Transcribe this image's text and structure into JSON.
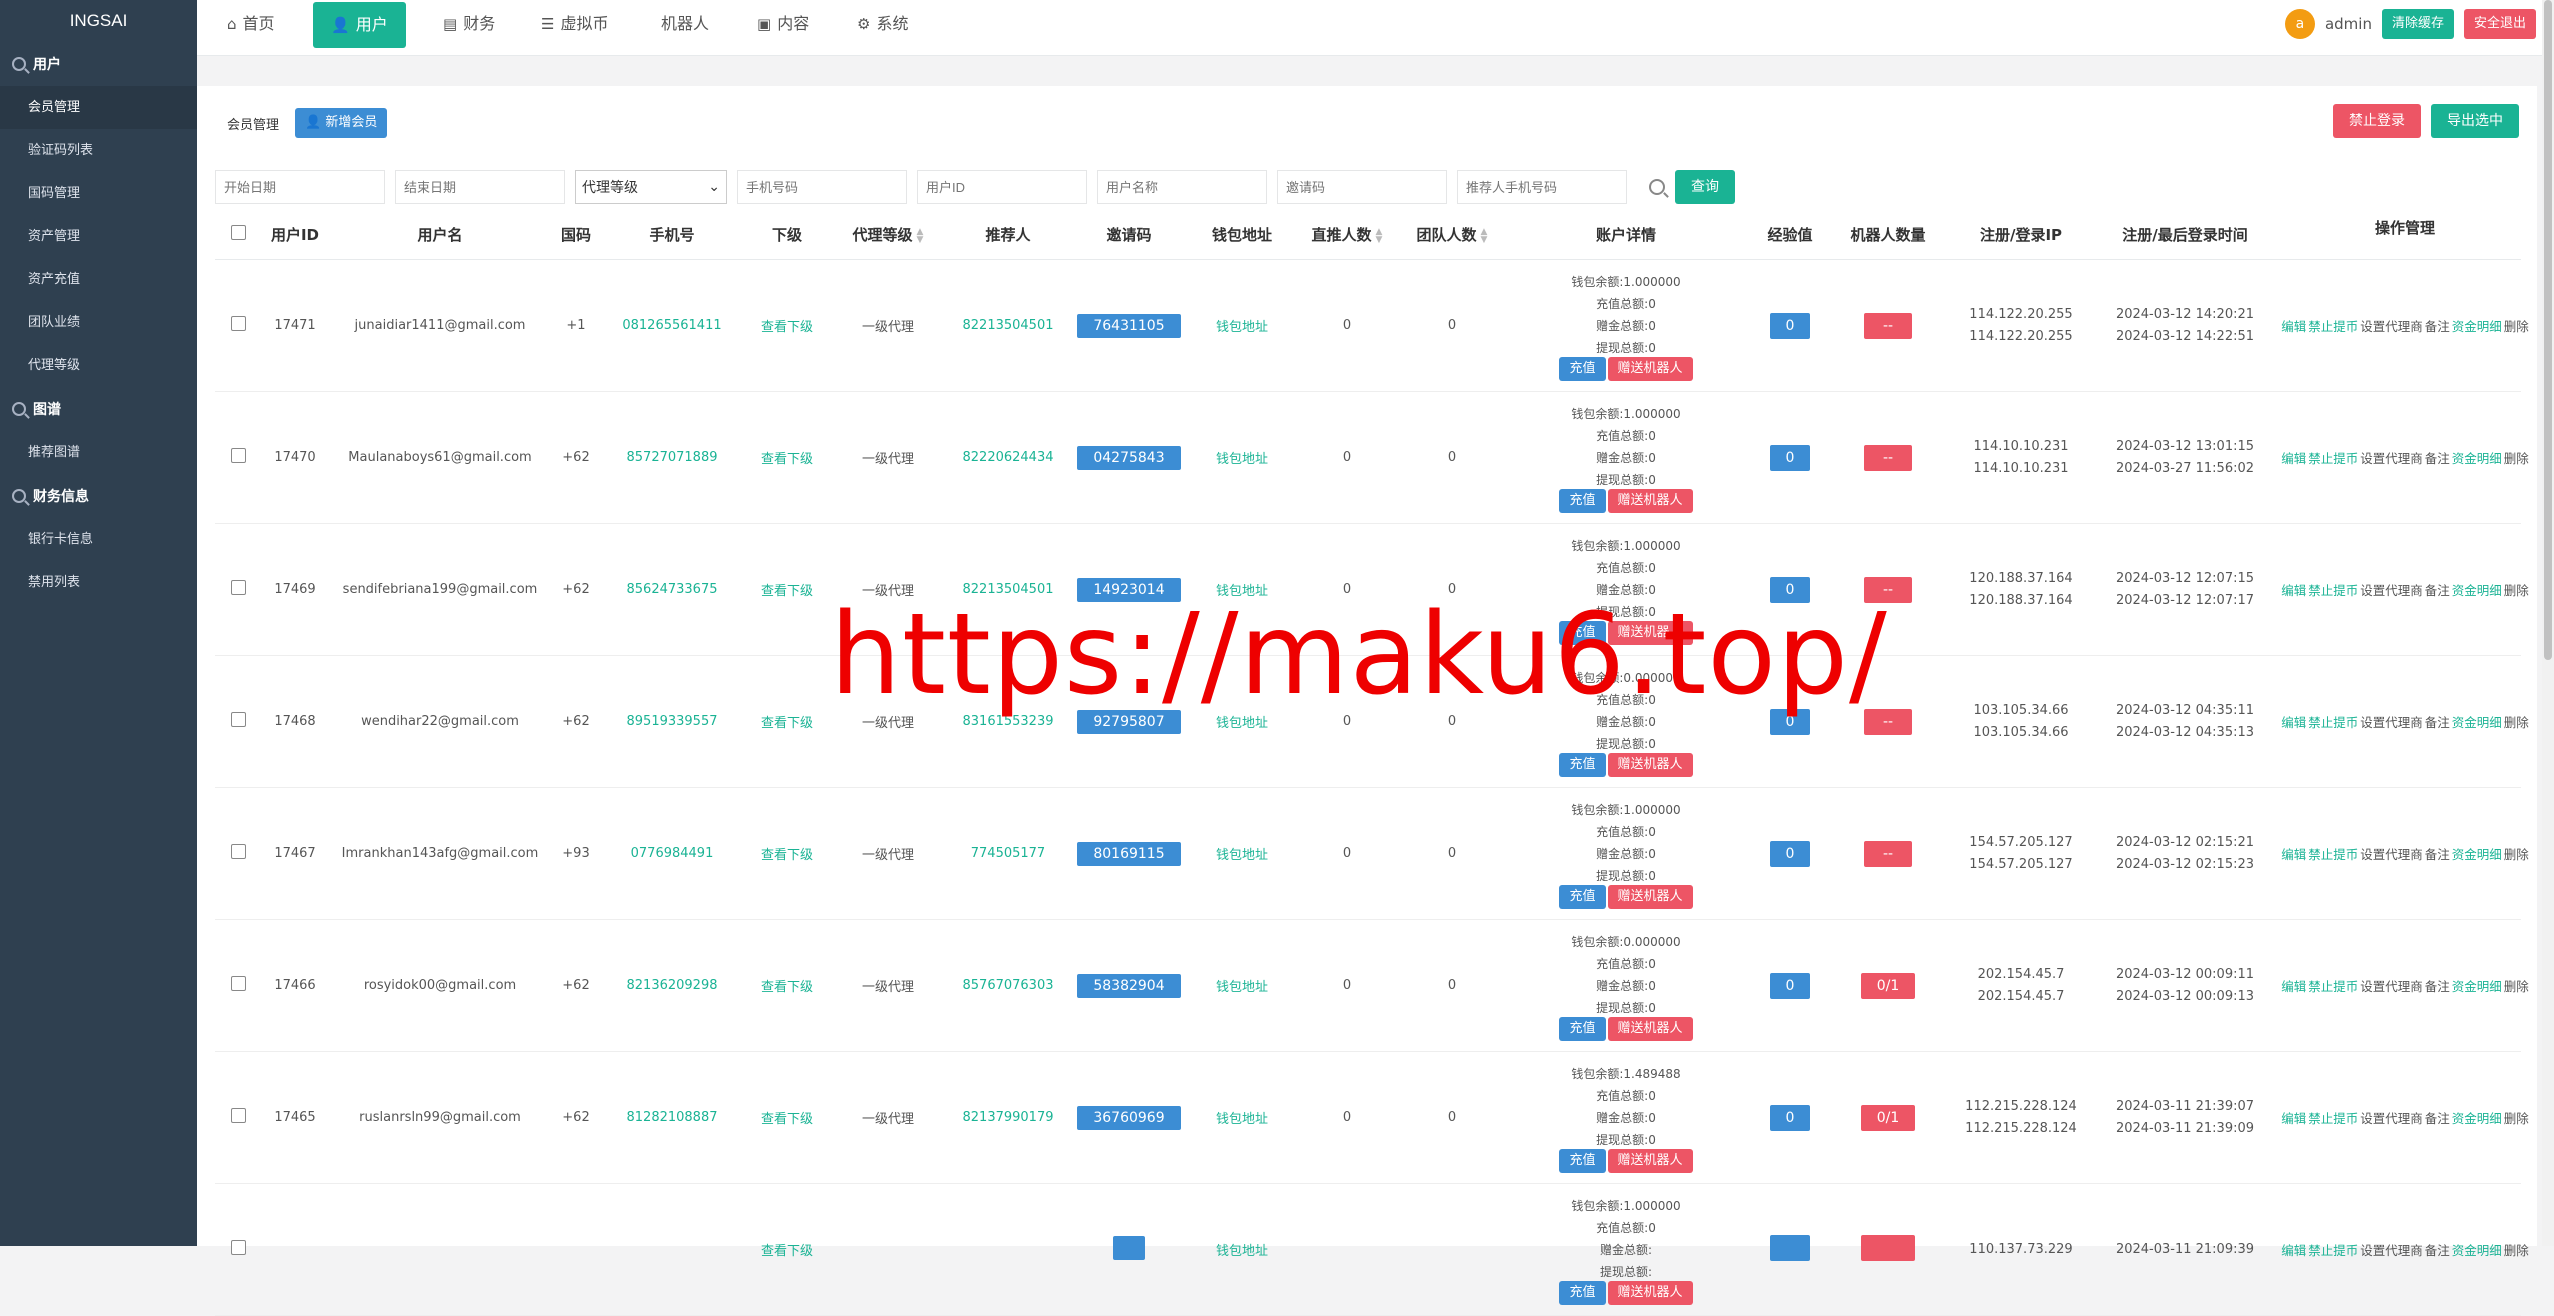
{
  "brand": "INGSAI",
  "sidebar": {
    "groups": [
      {
        "label": "用户",
        "items": [
          "会员管理",
          "验证码列表",
          "国码管理",
          "资产管理",
          "资产充值",
          "团队业绩",
          "代理等级"
        ]
      },
      {
        "label": "图谱",
        "items": [
          "推荐图谱"
        ]
      },
      {
        "label": "财务信息",
        "items": [
          "银行卡信息",
          "禁用列表"
        ]
      }
    ]
  },
  "topnav": {
    "tabs": [
      {
        "label": "首页",
        "icon": "home-icon"
      },
      {
        "label": "用户",
        "icon": "user-icon"
      },
      {
        "label": "财务",
        "icon": "wallet-icon"
      },
      {
        "label": "虚拟币",
        "icon": "database-icon"
      },
      {
        "label": "机器人",
        "icon": ""
      },
      {
        "label": "内容",
        "icon": "content-icon"
      },
      {
        "label": "系统",
        "icon": "gear-icon"
      }
    ],
    "avatar_letter": "a",
    "admin": "admin",
    "clear_cache": "清除缓存",
    "logout": "安全退出"
  },
  "page": {
    "title": "会员管理",
    "add_member": "新增会员",
    "ban_login": "禁止登录",
    "export": "导出选中"
  },
  "filters": {
    "start_date": "开始日期",
    "end_date": "结束日期",
    "agent_level": "代理等级",
    "phone": "手机号码",
    "user_id": "用户ID",
    "user_name": "用户名称",
    "invite_code": "邀请码",
    "referrer_phone": "推荐人手机号码",
    "query": "查询"
  },
  "table": {
    "headers": [
      "用户ID",
      "用户名",
      "国码",
      "手机号",
      "下级",
      "代理等级",
      "推荐人",
      "邀请码",
      "钱包地址",
      "直推人数",
      "团队人数",
      "账户详情",
      "经验值",
      "机器人数量",
      "注册/登录IP",
      "注册/最后登录时间",
      "操作管理"
    ],
    "acct_labels": {
      "balance": "钱包余额:",
      "recharge": "充值总额:",
      "gift": "赠金总额:",
      "withdraw": "提现总额:"
    },
    "btn_recharge": "充值",
    "btn_gift_robot": "赠送机器人",
    "view_sub": "查看下级",
    "wallet_link": "钱包地址",
    "ops": {
      "edit": "编辑",
      "ban_withdraw": "禁止提币",
      "set_agent": "设置代理商",
      "note": "备注",
      "funds": "资金明细",
      "delete": "删除"
    },
    "rows": [
      {
        "id": "17471",
        "name": "junaidiar1411@gmail.com",
        "cc": "+1",
        "phone": "081265561411",
        "level": "一级代理",
        "ref": "82213504501",
        "invite": "76431105",
        "direct": "0",
        "team": "0",
        "balance": "1.000000",
        "recharge": "0",
        "gift": "0",
        "withdraw": "0",
        "exp": "0",
        "robots": "--",
        "ip1": "114.122.20.255",
        "ip2": "114.122.20.255",
        "t1": "2024-03-12 14:20:21",
        "t2": "2024-03-12 14:22:51"
      },
      {
        "id": "17470",
        "name": "Maulanaboys61@gmail.com",
        "cc": "+62",
        "phone": "85727071889",
        "level": "一级代理",
        "ref": "82220624434",
        "invite": "04275843",
        "direct": "0",
        "team": "0",
        "balance": "1.000000",
        "recharge": "0",
        "gift": "0",
        "withdraw": "0",
        "exp": "0",
        "robots": "--",
        "ip1": "114.10.10.231",
        "ip2": "114.10.10.231",
        "t1": "2024-03-12 13:01:15",
        "t2": "2024-03-27 11:56:02"
      },
      {
        "id": "17469",
        "name": "sendifebriana199@gmail.com",
        "cc": "+62",
        "phone": "85624733675",
        "level": "一级代理",
        "ref": "82213504501",
        "invite": "14923014",
        "direct": "0",
        "team": "0",
        "balance": "1.000000",
        "recharge": "0",
        "gift": "0",
        "withdraw": "0",
        "exp": "0",
        "robots": "--",
        "ip1": "120.188.37.164",
        "ip2": "120.188.37.164",
        "t1": "2024-03-12 12:07:15",
        "t2": "2024-03-12 12:07:17"
      },
      {
        "id": "17468",
        "name": "wendihar22@gmail.com",
        "cc": "+62",
        "phone": "89519339557",
        "level": "一级代理",
        "ref": "83161553239",
        "invite": "92795807",
        "direct": "0",
        "team": "0",
        "balance": "0.000000",
        "recharge": "0",
        "gift": "0",
        "withdraw": "0",
        "exp": "0",
        "robots": "--",
        "ip1": "103.105.34.66",
        "ip2": "103.105.34.66",
        "t1": "2024-03-12 04:35:11",
        "t2": "2024-03-12 04:35:13"
      },
      {
        "id": "17467",
        "name": "Imrankhan143afg@gmail.com",
        "cc": "+93",
        "phone": "0776984491",
        "level": "一级代理",
        "ref": "774505177",
        "invite": "80169115",
        "direct": "0",
        "team": "0",
        "balance": "1.000000",
        "recharge": "0",
        "gift": "0",
        "withdraw": "0",
        "exp": "0",
        "robots": "--",
        "ip1": "154.57.205.127",
        "ip2": "154.57.205.127",
        "t1": "2024-03-12 02:15:21",
        "t2": "2024-03-12 02:15:23"
      },
      {
        "id": "17466",
        "name": "rosyidok00@gmail.com",
        "cc": "+62",
        "phone": "82136209298",
        "level": "一级代理",
        "ref": "85767076303",
        "invite": "58382904",
        "direct": "0",
        "team": "0",
        "balance": "0.000000",
        "recharge": "0",
        "gift": "0",
        "withdraw": "0",
        "exp": "0",
        "robots": "0/1",
        "ip1": "202.154.45.7",
        "ip2": "202.154.45.7",
        "t1": "2024-03-12 00:09:11",
        "t2": "2024-03-12 00:09:13"
      },
      {
        "id": "17465",
        "name": "ruslanrsln99@gmail.com",
        "cc": "+62",
        "phone": "81282108887",
        "level": "一级代理",
        "ref": "82137990179",
        "invite": "36760969",
        "direct": "0",
        "team": "0",
        "balance": "1.489488",
        "recharge": "0",
        "gift": "0",
        "withdraw": "0",
        "exp": "0",
        "robots": "0/1",
        "ip1": "112.215.228.124",
        "ip2": "112.215.228.124",
        "t1": "2024-03-11 21:39:07",
        "t2": "2024-03-11 21:39:09"
      },
      {
        "id": "",
        "name": "",
        "cc": "",
        "phone": "",
        "level": "",
        "ref": "",
        "invite": "",
        "direct": "",
        "team": "",
        "balance": "1.000000",
        "recharge": "0",
        "gift": "",
        "withdraw": "",
        "exp": "",
        "robots": "",
        "ip1": "110.137.73.229",
        "ip2": "",
        "t1": "2024-03-11 21:09:39",
        "t2": ""
      }
    ]
  },
  "watermark": "https://maku6.top/",
  "colors": {
    "primary": "#1ab394",
    "danger": "#ed5565",
    "info": "#3c8dd4",
    "sidebar": "#2f4050"
  }
}
